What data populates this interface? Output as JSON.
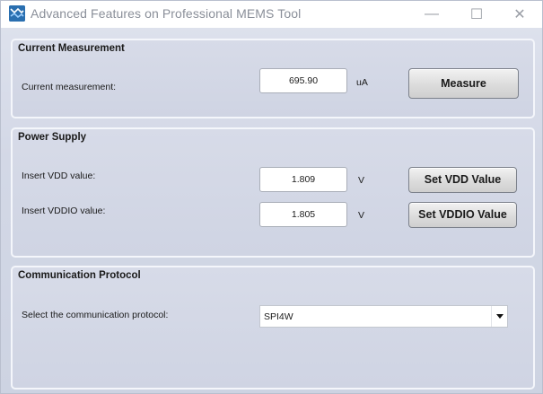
{
  "window": {
    "title": "Advanced Features on Professional MEMS Tool",
    "controls": {
      "minimize": "—",
      "maximize": "☐",
      "close": "✕"
    }
  },
  "current_measurement": {
    "title": "Current Measurement",
    "label": "Current measurement:",
    "value": "695.90",
    "unit": "uA",
    "button": "Measure"
  },
  "power_supply": {
    "title": "Power Supply",
    "vdd": {
      "label": "Insert VDD value:",
      "value": "1.809",
      "unit": "V",
      "button": "Set VDD Value"
    },
    "vddio": {
      "label": "Insert VDDIO value:",
      "value": "1.805",
      "unit": "V",
      "button": "Set VDDIO Value"
    }
  },
  "communication": {
    "title": "Communication Protocol",
    "label": "Select the communication protocol:",
    "selected": "SPI4W"
  }
}
